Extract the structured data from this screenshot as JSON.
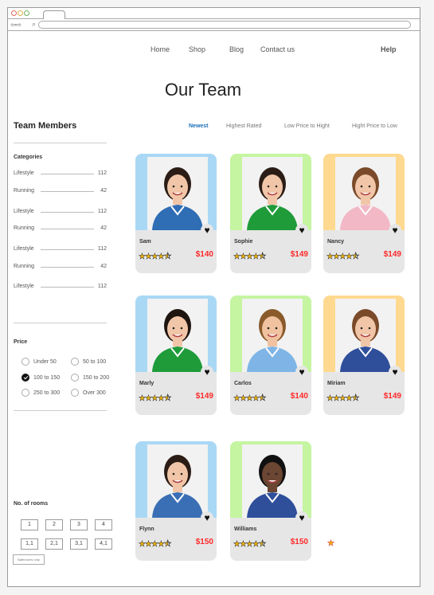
{
  "nav": {
    "items": [
      "Home",
      "Shop",
      "Blog",
      "Contact us"
    ],
    "help": "Help"
  },
  "page_title": "Our Team",
  "sidebar": {
    "title": "Team Members",
    "categories_label": "Categories",
    "categories": [
      {
        "name": "Lifestyle",
        "count": "112"
      },
      {
        "name": "Running",
        "count": "42"
      },
      {
        "name": "Lifestyle",
        "count": "112"
      },
      {
        "name": "Running",
        "count": "42"
      },
      {
        "name": "Lifestyle",
        "count": "112"
      },
      {
        "name": "Running",
        "count": "42"
      },
      {
        "name": "Lifestyle",
        "count": "112"
      }
    ],
    "price_label": "Price",
    "price_options": [
      {
        "label": "Under 50",
        "checked": false
      },
      {
        "label": "50 to 100",
        "checked": false
      },
      {
        "label": "100 to 150",
        "checked": true
      },
      {
        "label": "150 to 200",
        "checked": false
      },
      {
        "label": "250 to 300",
        "checked": false
      },
      {
        "label": "Over 300",
        "checked": false
      }
    ],
    "rooms_label": "No. of rooms",
    "rooms": [
      "1",
      "2",
      "3",
      "4",
      "1,1",
      "2,1",
      "3,1",
      "4,1"
    ],
    "bathrooms_label": "Bathrooms only"
  },
  "sort": {
    "options": [
      "Newest",
      "Highest Rated",
      "Low Price to Hight",
      "Hight Price to Low"
    ],
    "active": "Newest"
  },
  "members": [
    {
      "name": "Sam",
      "price": "$140",
      "rating": 4.5,
      "bg": "#a9d8f5",
      "shirt": "#2f6db5",
      "hair": "#2b1d16",
      "skin": "#f1c6a8"
    },
    {
      "name": "Sophie",
      "price": "$149",
      "rating": 4.5,
      "bg": "#c5f5a0",
      "shirt": "#1f9b3a",
      "hair": "#2b1d16",
      "skin": "#f1c6a8"
    },
    {
      "name": "Nancy",
      "price": "$149",
      "rating": 4.5,
      "bg": "#ffd98f",
      "shirt": "#f2b8c6",
      "hair": "#7a4a2a",
      "skin": "#f1c6a8"
    },
    {
      "name": "Marly",
      "price": "$149",
      "rating": 4.5,
      "bg": "#a9d8f5",
      "shirt": "#1f9b3a",
      "hair": "#1e1410",
      "skin": "#f1c6a8"
    },
    {
      "name": "Carlos",
      "price": "$140",
      "rating": 4.5,
      "bg": "#c5f5a0",
      "shirt": "#7fb5e6",
      "hair": "#8a5a2b",
      "skin": "#f0c2a0"
    },
    {
      "name": "Miriam",
      "price": "$149",
      "rating": 4.5,
      "bg": "#ffd98f",
      "shirt": "#2f4f9b",
      "hair": "#7a4a2a",
      "skin": "#f1c6a8"
    },
    {
      "name": "Flynn",
      "price": "$150",
      "rating": 4.5,
      "bg": "#a9d8f5",
      "shirt": "#3a6fb5",
      "hair": "#2b1d16",
      "skin": "#f1c6a8"
    },
    {
      "name": "Williams",
      "price": "$150",
      "rating": 4.5,
      "bg": "#c5f5a0",
      "shirt": "#2f4f9b",
      "hair": "#111111",
      "skin": "#6b4632"
    }
  ]
}
